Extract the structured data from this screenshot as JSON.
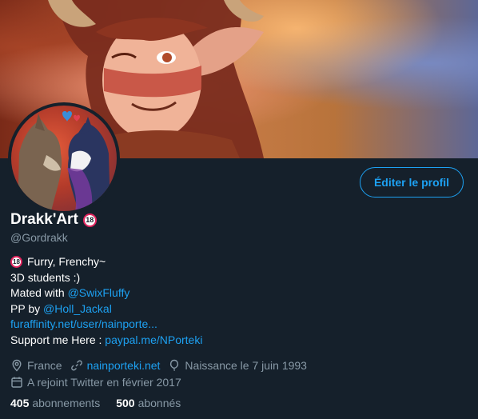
{
  "profile": {
    "edit_button": "Éditer le profil",
    "display_name": "Drakk'Art",
    "name_badge": "18",
    "handle": "@Gordrakk",
    "bio": {
      "badge": "18",
      "line1": "Furry, Frenchy~",
      "line2": "3D students :)",
      "line3_prefix": "Mated with ",
      "line3_link": "@SwixFluffy",
      "line4_prefix": "PP by ",
      "line4_link": "@Holl_Jackal",
      "line5_link": "furaffinity.net/user/nainporte...",
      "line6_prefix": "Support me Here : ",
      "line6_link": "paypal.me/NPorteki"
    },
    "meta": {
      "location": "France",
      "website": "nainporteki.net",
      "birthday": "Naissance le 7 juin 1993",
      "joined": "A rejoint Twitter en février 2017"
    },
    "stats": {
      "following_count": "405",
      "following_label": "abonnements",
      "followers_count": "500",
      "followers_label": "abonnés"
    }
  },
  "colors": {
    "background": "#15202b",
    "accent": "#1da1f2",
    "secondary_text": "#8899a6",
    "badge_ring": "#e0245e"
  },
  "icons": [
    "location-pin-icon",
    "link-icon",
    "balloon-icon",
    "calendar-icon"
  ]
}
